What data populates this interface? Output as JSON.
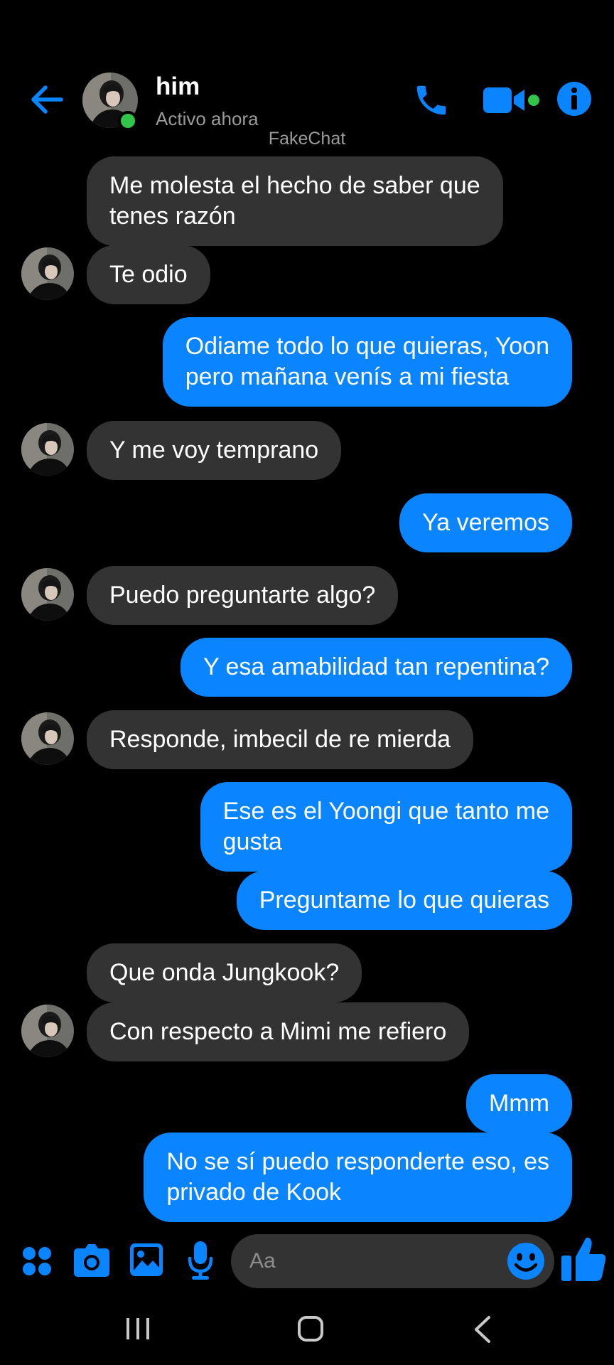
{
  "header": {
    "name": "him",
    "status": "Activo ahora",
    "watermark": "FakeChat"
  },
  "colors": {
    "accent": "#0a84ff",
    "incoming_bubble": "#333333",
    "online": "#31c54a",
    "background": "#000000"
  },
  "icons": {
    "back": "arrow-left-icon",
    "call": "phone-icon",
    "video": "video-camera-icon",
    "info": "info-icon",
    "apps": "apps-icon",
    "camera": "camera-icon",
    "gallery": "image-icon",
    "mic": "microphone-icon",
    "emoji": "smiley-icon",
    "like": "thumbs-up-icon"
  },
  "messages": [
    {
      "dir": "in",
      "lines": [
        "Me molesta el hecho de saber que",
        "tenes razón"
      ]
    },
    {
      "dir": "in",
      "lines": [
        "Te odio"
      ],
      "avatar": true
    },
    {
      "dir": "out",
      "lines": [
        "Odiame todo lo que quieras, Yoon",
        "pero mañana venís a mi fiesta"
      ]
    },
    {
      "dir": "in",
      "lines": [
        "Y me voy temprano"
      ],
      "avatar": true
    },
    {
      "dir": "out",
      "lines": [
        "Ya veremos"
      ]
    },
    {
      "dir": "in",
      "lines": [
        "Puedo preguntarte algo?"
      ],
      "avatar": true
    },
    {
      "dir": "out",
      "lines": [
        "Y esa amabilidad tan repentina?"
      ]
    },
    {
      "dir": "in",
      "lines": [
        "Responde, imbecil de re mierda"
      ],
      "avatar": true
    },
    {
      "dir": "out",
      "lines": [
        "Ese es el Yoongi que tanto me",
        "gusta"
      ]
    },
    {
      "dir": "out",
      "lines": [
        "Preguntame lo que quieras"
      ]
    },
    {
      "dir": "in",
      "lines": [
        "Que onda Jungkook?"
      ]
    },
    {
      "dir": "in",
      "lines": [
        "Con respecto a Mimi me refiero"
      ],
      "avatar": true
    },
    {
      "dir": "out",
      "lines": [
        "Mmm"
      ]
    },
    {
      "dir": "out",
      "lines": [
        "No se sí puedo responderte eso, es",
        "privado de Kook"
      ]
    }
  ],
  "composer": {
    "placeholder": "Aa"
  }
}
